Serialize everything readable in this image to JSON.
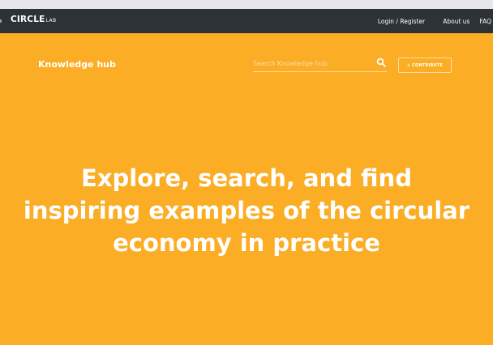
{
  "navbar": {
    "logo_main": "CIRCLE",
    "logo_sub": "LAB",
    "links": [
      "Login / Register",
      "About us",
      "FAQ"
    ]
  },
  "hub": {
    "title": "Knowledge hub",
    "search_placeholder": "Search Knowledge hub",
    "contribute_label": "+ CONTRIBUTE"
  },
  "hero": {
    "lines": [
      "Explore, search, and find",
      "inspiring examples of the circular",
      "economy in practice"
    ]
  },
  "colors": {
    "background": "#FAAD25",
    "navbar": "#2c3236",
    "text": "#ffffff"
  }
}
